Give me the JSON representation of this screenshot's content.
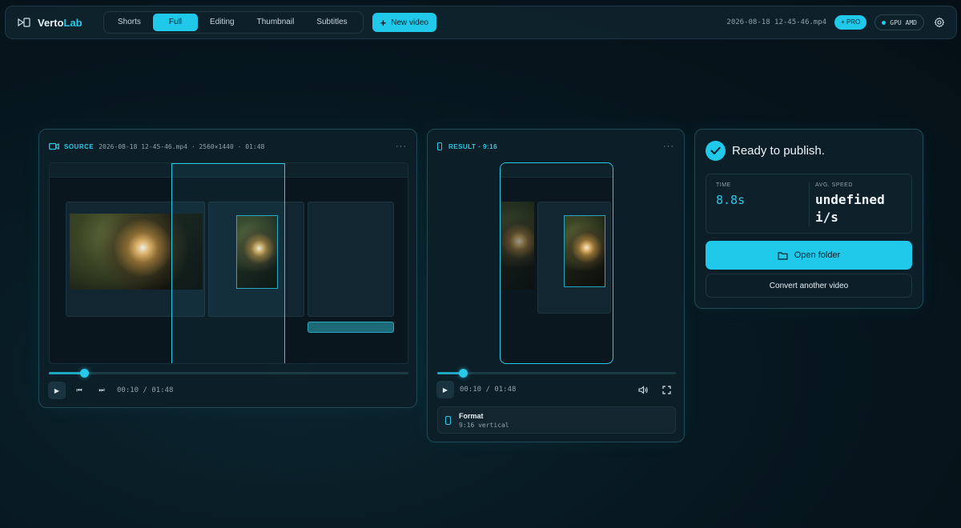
{
  "brand": {
    "name_prefix": "Verto",
    "name_accent": "Lab"
  },
  "tabs": [
    {
      "label": "Shorts"
    },
    {
      "label": "Full"
    },
    {
      "label": "Editing"
    },
    {
      "label": "Thumbnail"
    },
    {
      "label": "Subtitles"
    }
  ],
  "active_tab": "Full",
  "new_video_label": "New video",
  "top_right": {
    "file_name": "2026-08-18 12-45-46.mp4",
    "pro_label": "+ PRO",
    "gpu_label": "GPU AMD"
  },
  "source": {
    "title": "SOURCE",
    "meta": "2026-08-18 12-45-46.mp4 · 2560×1440 · 01:48",
    "timecode": "00:10 / 01:48",
    "progress": 0.1
  },
  "result": {
    "title": "RESULT · 9:16",
    "timecode": "00:10 / 01:48",
    "progress": 0.11,
    "format_title": "Format",
    "format_sub": "9:16 vertical"
  },
  "ready": {
    "title": "Ready to publish.",
    "time_label": "TIME",
    "time_value": "8.8s",
    "speed_label": "AVG. SPEED",
    "speed_value": "undefined i/s",
    "open_folder_label": "Open folder",
    "convert_another_label": "Convert another video"
  },
  "colors": {
    "accent": "#20c8ea",
    "background": "#071820",
    "panel": "#0d1f28"
  }
}
